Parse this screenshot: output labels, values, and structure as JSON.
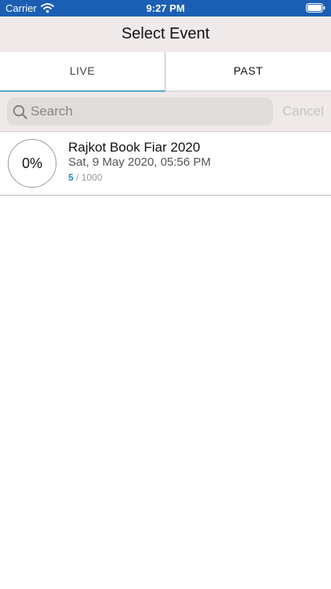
{
  "status_bar": {
    "carrier": "Carrier",
    "time": "9:27 PM",
    "icons": [
      "wifi-icon",
      "battery-icon"
    ]
  },
  "nav": {
    "title": "Select Event"
  },
  "tabs": [
    {
      "label": "LIVE",
      "selected": true
    },
    {
      "label": "PAST",
      "selected": false
    }
  ],
  "search": {
    "placeholder": "Search",
    "value": "",
    "cancel_label": "Cancel",
    "icon": "search-icon"
  },
  "events": [
    {
      "progress": "0%",
      "name": "Rajkot Book Fiar 2020",
      "date": "Sat, 9 May 2020, 05:56 PM",
      "count_current": "5",
      "count_total": " / 1000"
    }
  ],
  "colors": {
    "status_bar": "#1a5fb4",
    "nav_bar": "#efe9e9",
    "tab_indicator": "#5aa6cf",
    "count_accent": "#1e88c8"
  }
}
